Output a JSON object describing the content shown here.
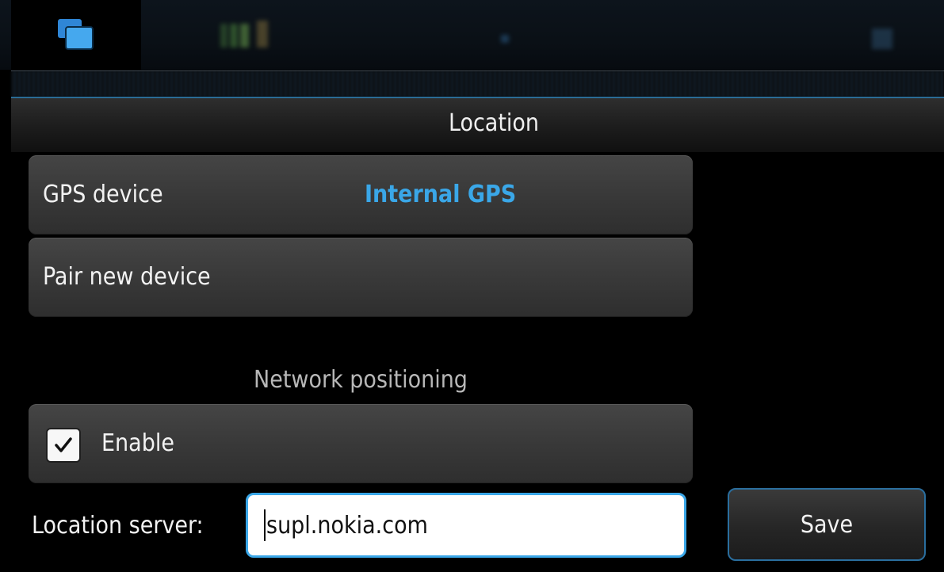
{
  "dialog": {
    "title": "Location"
  },
  "gps": {
    "label": "GPS device",
    "value": "Internal GPS"
  },
  "pair": {
    "label": "Pair new device"
  },
  "network": {
    "section_label": "Network positioning",
    "enable_label": "Enable",
    "enable_checked": true
  },
  "server": {
    "label": "Location server:",
    "value": "supl.nokia.com"
  },
  "actions": {
    "save_label": "Save"
  },
  "colors": {
    "accent": "#3aa7e8",
    "background": "#000000",
    "row": "#3c3c3c"
  },
  "icons": {
    "task_switcher": "task-switcher-icon",
    "checkbox": "check-icon"
  }
}
